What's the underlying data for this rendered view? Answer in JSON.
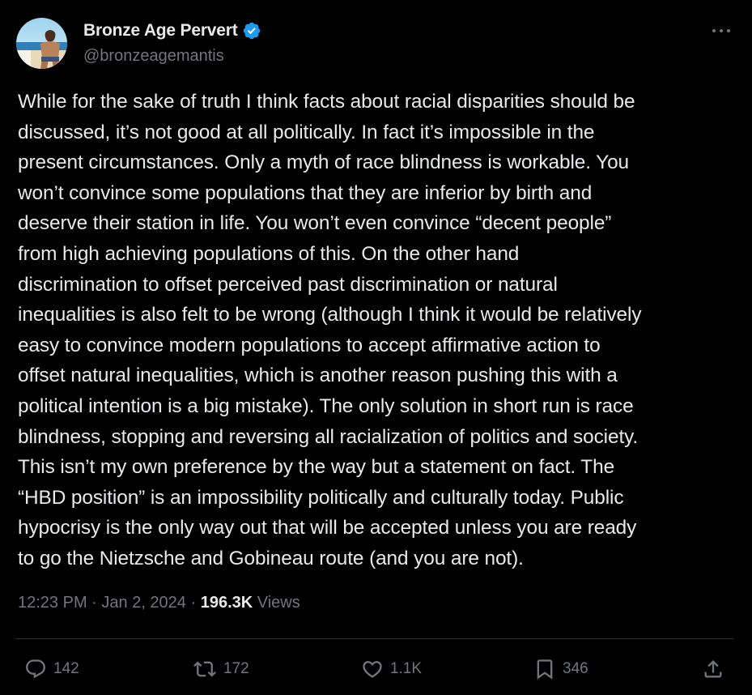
{
  "author": {
    "display_name": "Bronze Age Pervert",
    "handle": "@bronzeagemantis",
    "verified": true,
    "avatar_icon": "avatar-photo"
  },
  "tweet": {
    "lines": [
      "While for the sake of truth I think facts about racial disparities should be",
      "discussed, it’s not good at all politically. In fact it’s impossible in the",
      "present circumstances. Only a myth of race blindness is workable. You",
      "won’t convince some populations that they are inferior by birth and",
      "deserve their station in life. You won’t even convince “decent people”",
      "from high achieving populations of this. On the other hand",
      "discrimination to offset perceived past discrimination or natural",
      "inequalities is also felt to be wrong (although I think it would be relatively",
      "easy to convince modern populations to accept affirmative action to",
      "offset natural inequalities, which is another reason pushing this with a",
      "political intention is a big mistake). The only solution in short run is race",
      "blindness, stopping and reversing all racialization of politics and society.",
      "This isn’t my own preference by the way but a statement on fact. The",
      "“HBD position” is an impossibility politically and culturally today. Public",
      "hypocrisy is the only way out that will be accepted unless you are ready",
      "to go the Nietzsche and Gobineau route (and you are not)."
    ]
  },
  "meta": {
    "time": "12:23 PM",
    "separator": " · ",
    "date": "Jan 2, 2024",
    "views_count": "196.3K",
    "views_label": " Views"
  },
  "actions": {
    "replies": "142",
    "reposts": "172",
    "likes": "1.1K",
    "bookmarks": "346"
  },
  "colors": {
    "background": "#000000",
    "text": "#e7e9ea",
    "secondary": "#71767b",
    "verified": "#1d9bf0",
    "divider": "#2f3336"
  }
}
